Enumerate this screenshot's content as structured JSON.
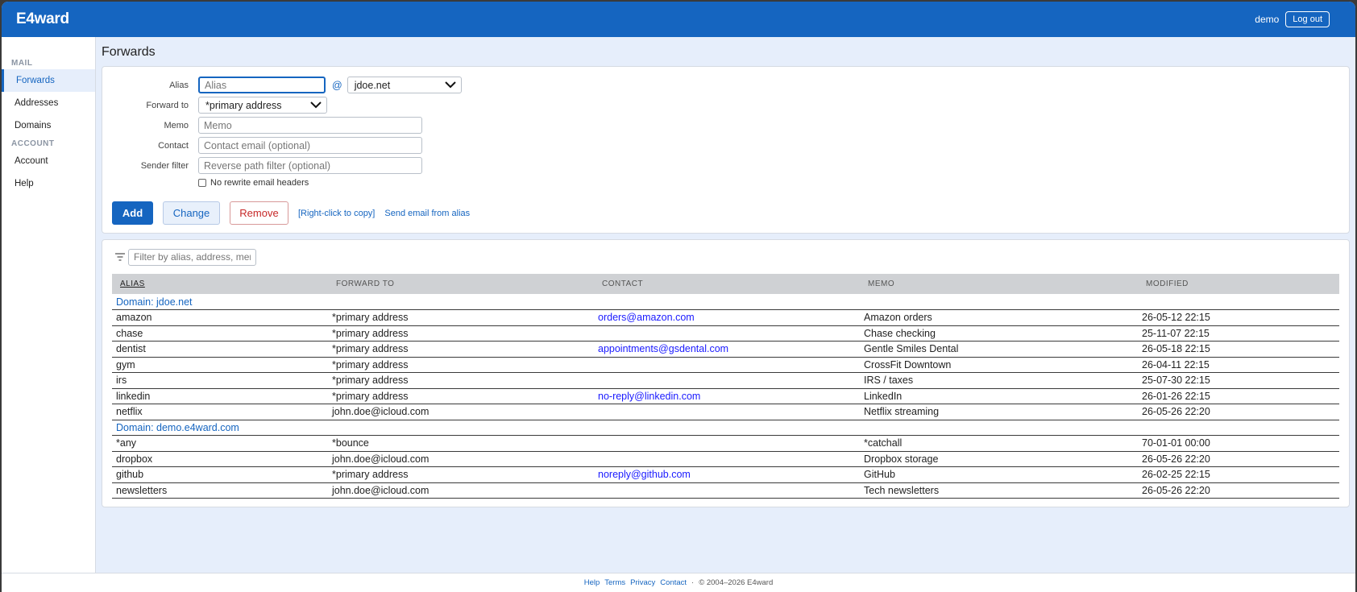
{
  "header": {
    "brand": "E4ward",
    "user": "demo",
    "logout_label": "Log out"
  },
  "sidebar": {
    "section_mail": "MAIL",
    "mail_items": [
      {
        "label": "Forwards"
      },
      {
        "label": "Addresses"
      },
      {
        "label": "Domains"
      }
    ],
    "section_account": "ACCOUNT",
    "account_items": [
      {
        "label": "Account"
      },
      {
        "label": "Help"
      }
    ]
  },
  "page": {
    "title": "Forwards"
  },
  "form": {
    "alias_label": "Alias",
    "alias_placeholder": "Alias",
    "at": "@",
    "domain_value": "jdoe.net",
    "forward_label": "Forward to",
    "forward_value": "*primary address",
    "memo_label": "Memo",
    "memo_placeholder": "Memo",
    "contact_label": "Contact",
    "contact_placeholder": "Contact email (optional)",
    "sender_label": "Sender filter",
    "sender_placeholder": "Reverse path filter (optional)",
    "no_rewrite_label": "No rewrite email headers",
    "add_label": "Add",
    "change_label": "Change",
    "remove_label": "Remove",
    "copy_link": "[Right-click to copy]",
    "send_link": "Send email from alias"
  },
  "filter": {
    "placeholder": "Filter by alias, address, memo"
  },
  "table": {
    "columns": [
      "ALIAS",
      "FORWARD TO",
      "CONTACT",
      "MEMO",
      "MODIFIED"
    ],
    "groups": [
      {
        "label": "Domain: jdoe.net",
        "rows": [
          [
            "amazon",
            "*primary address",
            "orders@amazon.com",
            "Amazon orders",
            "26-05-12 22:15"
          ],
          [
            "chase",
            "*primary address",
            "",
            "Chase checking",
            "25-11-07 22:15"
          ],
          [
            "dentist",
            "*primary address",
            "appointments@gsdental.com",
            "Gentle Smiles Dental",
            "26-05-18 22:15"
          ],
          [
            "gym",
            "*primary address",
            "",
            "CrossFit Downtown",
            "26-04-11 22:15"
          ],
          [
            "irs",
            "*primary address",
            "",
            "IRS / taxes",
            "25-07-30 22:15"
          ],
          [
            "linkedin",
            "*primary address",
            "no-reply@linkedin.com",
            "LinkedIn",
            "26-01-26 22:15"
          ],
          [
            "netflix",
            "john.doe@icloud.com",
            "",
            "Netflix streaming",
            "26-05-26 22:20"
          ]
        ]
      },
      {
        "label": "Domain: demo.e4ward.com",
        "rows": [
          [
            "*any",
            "*bounce",
            "",
            "*catchall",
            "70-01-01 00:00"
          ],
          [
            "dropbox",
            "john.doe@icloud.com",
            "",
            "Dropbox storage",
            "26-05-26 22:20"
          ],
          [
            "github",
            "*primary address",
            "noreply@github.com",
            "GitHub",
            "26-02-25 22:15"
          ],
          [
            "newsletters",
            "john.doe@icloud.com",
            "",
            "Tech newsletters",
            "26-05-26 22:20"
          ]
        ]
      }
    ]
  },
  "footer": {
    "links": [
      "Help",
      "Terms",
      "Privacy",
      "Contact"
    ],
    "separator": "·",
    "copyright": "© 2004–2026 E4ward"
  }
}
